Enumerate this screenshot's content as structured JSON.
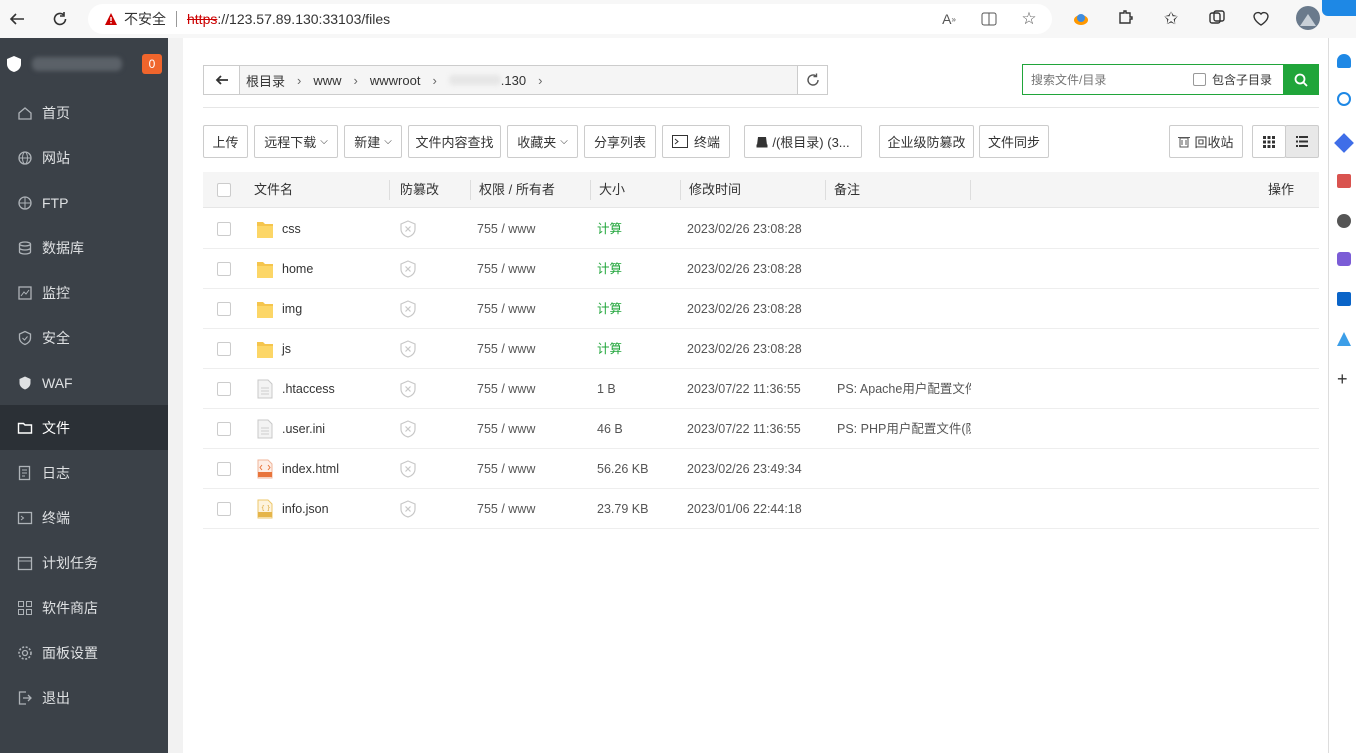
{
  "browser": {
    "unsafe_label": "不安全",
    "url_protocol": "https",
    "url_rest": "://123.57.89.130:33103/files"
  },
  "sidebar": {
    "badge": "0",
    "items": [
      {
        "label": "首页",
        "icon": "home-icon"
      },
      {
        "label": "网站",
        "icon": "globe-icon"
      },
      {
        "label": "FTP",
        "icon": "ftp-icon"
      },
      {
        "label": "数据库",
        "icon": "database-icon"
      },
      {
        "label": "监控",
        "icon": "monitor-icon"
      },
      {
        "label": "安全",
        "icon": "security-icon"
      },
      {
        "label": "WAF",
        "icon": "waf-icon"
      },
      {
        "label": "文件",
        "icon": "folder-icon"
      },
      {
        "label": "日志",
        "icon": "log-icon"
      },
      {
        "label": "终端",
        "icon": "terminal-icon"
      },
      {
        "label": "计划任务",
        "icon": "calendar-icon"
      },
      {
        "label": "软件商店",
        "icon": "store-icon"
      },
      {
        "label": "面板设置",
        "icon": "settings-icon"
      },
      {
        "label": "退出",
        "icon": "logout-icon"
      }
    ],
    "active_index": 7
  },
  "path": {
    "crumbs": [
      "根目录",
      "www",
      "wwwroot",
      ".130"
    ]
  },
  "search": {
    "placeholder": "搜索文件/目录",
    "sub_label": "包含子目录"
  },
  "toolbar": {
    "upload": "上传",
    "remote_download": "远程下载",
    "new": "新建",
    "content_search": "文件内容查找",
    "favorites": "收藏夹",
    "share_list": "分享列表",
    "terminal": "终端",
    "disk": "/(根目录) (3...",
    "tamper": "企业级防篡改",
    "sync": "文件同步",
    "recycle": "回收站"
  },
  "table": {
    "headers": {
      "name": "文件名",
      "tamper": "防篡改",
      "perm": "权限 / 所有者",
      "size": "大小",
      "mtime": "修改时间",
      "note": "备注",
      "op": "操作"
    },
    "rows": [
      {
        "type": "folder",
        "name": "css",
        "perm": "755 / www",
        "size": "计算",
        "mtime": "2023/02/26 23:08:28",
        "note": ""
      },
      {
        "type": "folder",
        "name": "home",
        "perm": "755 / www",
        "size": "计算",
        "mtime": "2023/02/26 23:08:28",
        "note": ""
      },
      {
        "type": "folder",
        "name": "img",
        "perm": "755 / www",
        "size": "计算",
        "mtime": "2023/02/26 23:08:28",
        "note": ""
      },
      {
        "type": "folder",
        "name": "js",
        "perm": "755 / www",
        "size": "计算",
        "mtime": "2023/02/26 23:08:28",
        "note": ""
      },
      {
        "type": "file",
        "name": ".htaccess",
        "perm": "755 / www",
        "size": "1 B",
        "mtime": "2023/07/22 11:36:55",
        "note": "PS: Apache用户配置文件"
      },
      {
        "type": "file",
        "name": ".user.ini",
        "perm": "755 / www",
        "size": "46 B",
        "mtime": "2023/07/22 11:36:55",
        "note": "PS: PHP用户配置文件(防"
      },
      {
        "type": "html",
        "name": "index.html",
        "perm": "755 / www",
        "size": "56.26 KB",
        "mtime": "2023/02/26 23:49:34",
        "note": ""
      },
      {
        "type": "json",
        "name": "info.json",
        "perm": "755 / www",
        "size": "23.79 KB",
        "mtime": "2023/01/06 22:44:18",
        "note": ""
      }
    ]
  },
  "colors": {
    "accent": "#20a53a",
    "sidebar": "#3b4148",
    "badge": "#f0652c"
  }
}
